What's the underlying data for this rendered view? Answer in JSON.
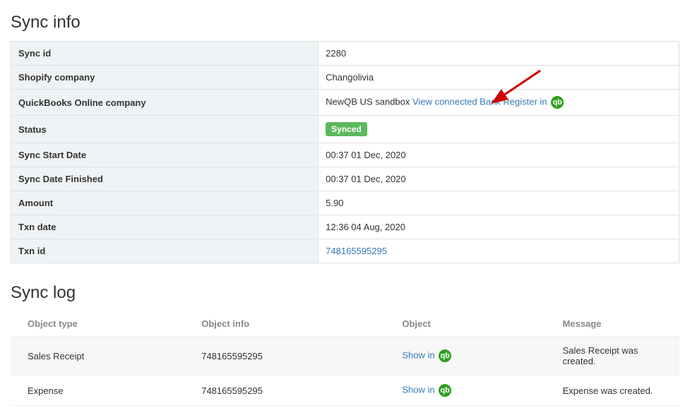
{
  "titles": {
    "sync_info": "Sync info",
    "sync_log": "Sync log"
  },
  "info": {
    "sync_id": {
      "label": "Sync id",
      "value": "2280"
    },
    "shopify_company": {
      "label": "Shopify company",
      "value": "Changolivia"
    },
    "qb_company": {
      "label": "QuickBooks Online company",
      "value": "NewQB US sandbox",
      "link_text": "View connected Bank Register in"
    },
    "status": {
      "label": "Status",
      "badge": "Synced"
    },
    "sync_start": {
      "label": "Sync Start Date",
      "value": "00:37 01 Dec, 2020"
    },
    "sync_finished": {
      "label": "Sync Date Finished",
      "value": "00:37 01 Dec, 2020"
    },
    "amount": {
      "label": "Amount",
      "value": "5.90"
    },
    "txn_date": {
      "label": "Txn date",
      "value": "12:36 04 Aug, 2020"
    },
    "txn_id": {
      "label": "Txn id",
      "value": "748165595295"
    }
  },
  "log": {
    "headers": {
      "object_type": "Object type",
      "object_info": "Object info",
      "object": "Object",
      "message": "Message"
    },
    "rows": [
      {
        "type": "Sales Receipt",
        "info": "748165595295",
        "link": "Show in",
        "message": "Sales Receipt was created."
      },
      {
        "type": "Expense",
        "info": "748165595295",
        "link": "Show in",
        "message": "Expense was created."
      }
    ]
  },
  "icons": {
    "qb_glyph": "qb"
  }
}
